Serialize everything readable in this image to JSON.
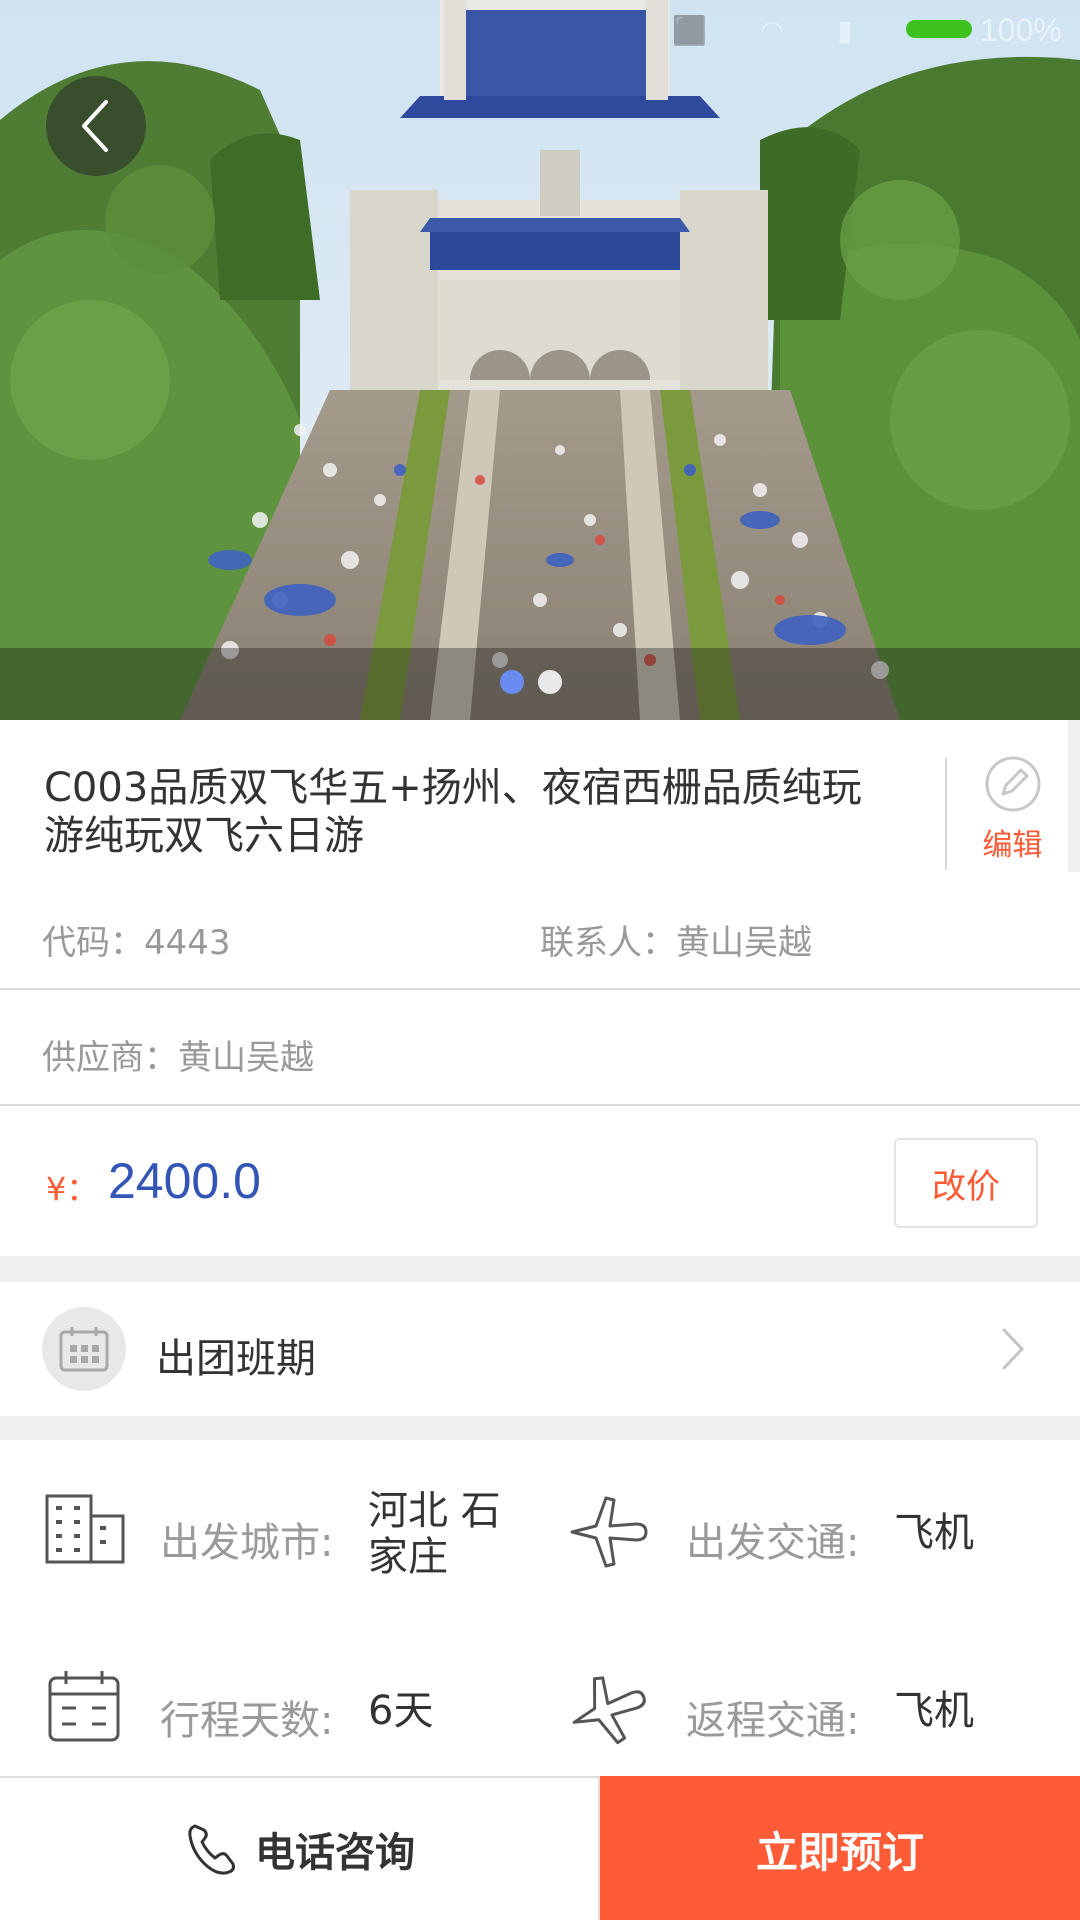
{
  "status_bar": {
    "battery_text": "100%",
    "battery_color": "#3cc11f"
  },
  "hero": {
    "carousel_count": 2,
    "active_index": 0,
    "dot_active_color": "#6a8cf0"
  },
  "product": {
    "title": "C003品质双飞华五+扬州、夜宿西栅品质纯玩游纯玩双飞六日游",
    "edit_label": "编辑"
  },
  "info": {
    "code_label": "代码：",
    "code_value": "4443",
    "contact_label": "联系人：",
    "contact_value": "黄山吴越",
    "supplier_label": "供应商：",
    "supplier_value": "黄山吴越"
  },
  "price": {
    "symbol": "¥：",
    "value": "2400.0",
    "reprice_label": "改价",
    "value_color": "#3355b5"
  },
  "schedule": {
    "label": "出团班期"
  },
  "details": {
    "depart_city_label": "出发城市:",
    "depart_city_value": "河北 石家庄",
    "depart_transport_label": "出发交通:",
    "depart_transport_value": "飞机",
    "days_label": "行程天数:",
    "days_value": "6天",
    "return_transport_label": "返程交通:",
    "return_transport_value": "飞机"
  },
  "bottom_bar": {
    "phone_label": "电话咨询",
    "book_label": "立即预订",
    "accent_color": "#ff5b37"
  }
}
